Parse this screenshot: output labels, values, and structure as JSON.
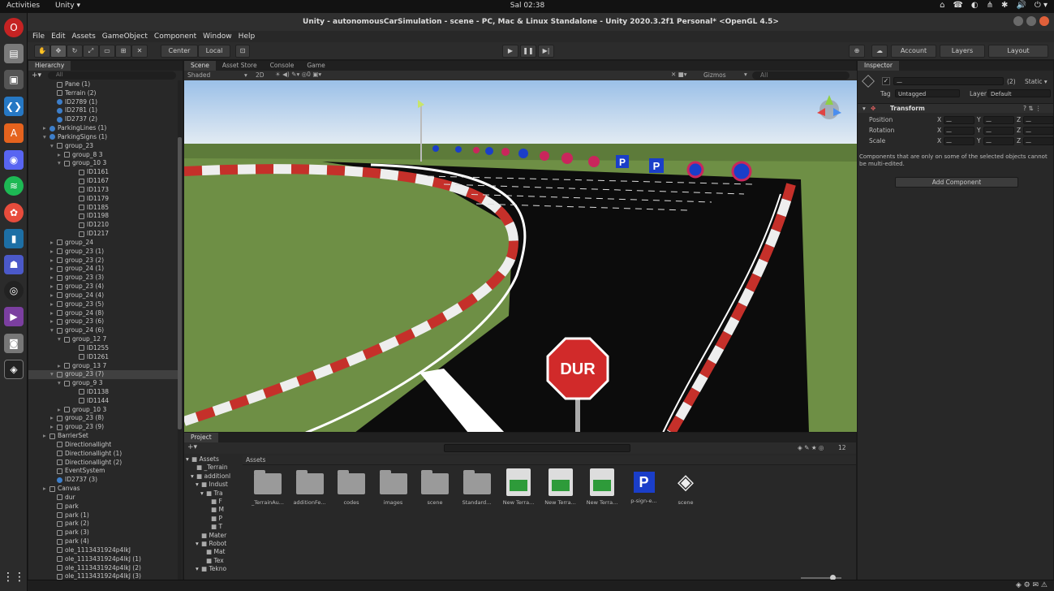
{
  "gnome": {
    "activities": "Activities",
    "app": "Unity ▾",
    "clock": "Sal 02:38",
    "tray": [
      "⌂",
      "☎",
      "◐",
      "⋔",
      "✱",
      "🔊",
      "⏻ ▾"
    ]
  },
  "title": "Unity - autonomousCarSimulation - scene - PC, Mac & Linux Standalone - Unity 2020.3.2f1 Personal* <OpenGL 4.5>",
  "menu": [
    "File",
    "Edit",
    "Assets",
    "GameObject",
    "Component",
    "Window",
    "Help"
  ],
  "toolbar": {
    "center": "Center",
    "local": "Local",
    "account": "Account",
    "layers": "Layers",
    "layout": "Layout"
  },
  "hierarchy": {
    "tab": "Hierarchy",
    "search_placeholder": "All",
    "rows": [
      {
        "t": "Pane (1)",
        "d": 3,
        "i": "cube"
      },
      {
        "t": "Terrain (2)",
        "d": 3,
        "i": "cube"
      },
      {
        "t": "ID2789 (1)",
        "d": 3,
        "i": "blue"
      },
      {
        "t": "ID2781 (1)",
        "d": 3,
        "i": "blue"
      },
      {
        "t": "ID2737 (2)",
        "d": 3,
        "i": "blue"
      },
      {
        "t": "ParkingLines (1)",
        "d": 2,
        "i": "blue",
        "a": "▸"
      },
      {
        "t": "ParkingSigns (1)",
        "d": 2,
        "i": "blue",
        "a": "▾"
      },
      {
        "t": "group_23",
        "d": 3,
        "i": "cube",
        "a": "▾"
      },
      {
        "t": "group_8 3",
        "d": 4,
        "i": "cube",
        "a": "▸"
      },
      {
        "t": "group_10 3",
        "d": 4,
        "i": "cube",
        "a": "▾"
      },
      {
        "t": "ID1161",
        "d": 6,
        "i": "cube"
      },
      {
        "t": "ID1167",
        "d": 6,
        "i": "cube"
      },
      {
        "t": "ID1173",
        "d": 6,
        "i": "cube"
      },
      {
        "t": "ID1179",
        "d": 6,
        "i": "cube"
      },
      {
        "t": "ID1185",
        "d": 6,
        "i": "cube"
      },
      {
        "t": "ID1198",
        "d": 6,
        "i": "cube"
      },
      {
        "t": "ID1210",
        "d": 6,
        "i": "cube"
      },
      {
        "t": "ID1217",
        "d": 6,
        "i": "cube"
      },
      {
        "t": "group_24",
        "d": 3,
        "i": "cube",
        "a": "▸"
      },
      {
        "t": "group_23 (1)",
        "d": 3,
        "i": "cube",
        "a": "▸"
      },
      {
        "t": "group_23 (2)",
        "d": 3,
        "i": "cube",
        "a": "▸"
      },
      {
        "t": "group_24 (1)",
        "d": 3,
        "i": "cube",
        "a": "▸"
      },
      {
        "t": "group_23 (3)",
        "d": 3,
        "i": "cube",
        "a": "▸"
      },
      {
        "t": "group_23 (4)",
        "d": 3,
        "i": "cube",
        "a": "▸"
      },
      {
        "t": "group_24 (4)",
        "d": 3,
        "i": "cube",
        "a": "▸"
      },
      {
        "t": "group_23 (5)",
        "d": 3,
        "i": "cube",
        "a": "▸"
      },
      {
        "t": "group_24 (8)",
        "d": 3,
        "i": "cube",
        "a": "▸"
      },
      {
        "t": "group_23 (6)",
        "d": 3,
        "i": "cube",
        "a": "▸"
      },
      {
        "t": "group_24 (6)",
        "d": 3,
        "i": "cube",
        "a": "▾"
      },
      {
        "t": "group_12 7",
        "d": 4,
        "i": "cube",
        "a": "▾"
      },
      {
        "t": "ID1255",
        "d": 6,
        "i": "cube"
      },
      {
        "t": "ID1261",
        "d": 6,
        "i": "cube"
      },
      {
        "t": "group_13 7",
        "d": 4,
        "i": "cube",
        "a": "▸"
      },
      {
        "t": "group_23 (7)",
        "d": 3,
        "i": "cube",
        "a": "▾",
        "sel": true
      },
      {
        "t": "group_9 3",
        "d": 4,
        "i": "cube",
        "a": "▾"
      },
      {
        "t": "ID1138",
        "d": 6,
        "i": "cube"
      },
      {
        "t": "ID1144",
        "d": 6,
        "i": "cube"
      },
      {
        "t": "group_10 3",
        "d": 4,
        "i": "cube",
        "a": "▸"
      },
      {
        "t": "group_23 (8)",
        "d": 3,
        "i": "cube",
        "a": "▸"
      },
      {
        "t": "group_23 (9)",
        "d": 3,
        "i": "cube",
        "a": "▸"
      },
      {
        "t": "BarrierSet",
        "d": 2,
        "i": "cube",
        "a": "▸"
      },
      {
        "t": "Directionallight",
        "d": 3,
        "i": "cube"
      },
      {
        "t": "Directionallight (1)",
        "d": 3,
        "i": "cube"
      },
      {
        "t": "Directionallight (2)",
        "d": 3,
        "i": "cube"
      },
      {
        "t": "EventSystem",
        "d": 3,
        "i": "cube"
      },
      {
        "t": "ID2737 (3)",
        "d": 3,
        "i": "blue"
      },
      {
        "t": "Canvas",
        "d": 2,
        "i": "cube",
        "a": "▸"
      },
      {
        "t": "dur",
        "d": 3,
        "i": "cube"
      },
      {
        "t": "park",
        "d": 3,
        "i": "cube"
      },
      {
        "t": "park (1)",
        "d": 3,
        "i": "cube"
      },
      {
        "t": "park (2)",
        "d": 3,
        "i": "cube"
      },
      {
        "t": "park (3)",
        "d": 3,
        "i": "cube"
      },
      {
        "t": "park (4)",
        "d": 3,
        "i": "cube"
      },
      {
        "t": "ole_1113431924p4lkJ",
        "d": 3,
        "i": "cube"
      },
      {
        "t": "ole_1113431924p4lkJ (1)",
        "d": 3,
        "i": "cube"
      },
      {
        "t": "ole_1113431924p4lkJ (2)",
        "d": 3,
        "i": "cube"
      },
      {
        "t": "ole_1113431924p4lkJ (3)",
        "d": 3,
        "i": "cube"
      }
    ]
  },
  "scene": {
    "tabs": [
      "Scene",
      "Asset Store",
      "Console",
      "Game"
    ],
    "shading": "Shaded",
    "mode2d": "2D",
    "gizmos": "Gizmos",
    "search_placeholder": "All",
    "stop_sign": "DUR",
    "parking_letter": "P"
  },
  "inspector": {
    "tab": "Inspector",
    "static": "Static ▾",
    "tag_label": "Tag",
    "tag_value": "Untagged",
    "layer_label": "Layer",
    "layer_value": "Default",
    "name_placeholder": "—",
    "count": "(2)",
    "transform": "Transform",
    "rows": [
      "Position",
      "Rotation",
      "Scale"
    ],
    "axes": [
      "X",
      "Y",
      "Z"
    ],
    "dash": "—",
    "note": "Components that are only on some of the selected objects cannot be multi-edited.",
    "add_component": "Add Component"
  },
  "project": {
    "tab": "Project",
    "assets_header": "Assets",
    "tree": [
      {
        "t": "Assets",
        "d": 0,
        "a": "▾"
      },
      {
        "t": "_Terrain",
        "d": 1
      },
      {
        "t": "additionl",
        "d": 1,
        "a": "▾"
      },
      {
        "t": "Indust",
        "d": 2,
        "a": "▾"
      },
      {
        "t": "Tra",
        "d": 3,
        "a": "▾"
      },
      {
        "t": "F",
        "d": 4
      },
      {
        "t": "M",
        "d": 4
      },
      {
        "t": "P",
        "d": 4
      },
      {
        "t": "T",
        "d": 4
      },
      {
        "t": "Mater",
        "d": 2
      },
      {
        "t": "Robot",
        "d": 2,
        "a": "▾"
      },
      {
        "t": "Mat",
        "d": 3
      },
      {
        "t": "Tex",
        "d": 3
      },
      {
        "t": "Tekno",
        "d": 2,
        "a": "▾"
      }
    ],
    "assets": [
      {
        "label": "_TerrainAu...",
        "kind": "folder"
      },
      {
        "label": "additionFe...",
        "kind": "folder"
      },
      {
        "label": "codes",
        "kind": "folder"
      },
      {
        "label": "images",
        "kind": "folder"
      },
      {
        "label": "scene",
        "kind": "folder"
      },
      {
        "label": "Standard...",
        "kind": "folder"
      },
      {
        "label": "New Terra...",
        "kind": "terrain"
      },
      {
        "label": "New Terra...",
        "kind": "terrain"
      },
      {
        "label": "New Terra...",
        "kind": "terrain"
      },
      {
        "label": "p-sign-e...",
        "kind": "park"
      },
      {
        "label": "scene",
        "kind": "unity"
      }
    ],
    "count": "12"
  }
}
